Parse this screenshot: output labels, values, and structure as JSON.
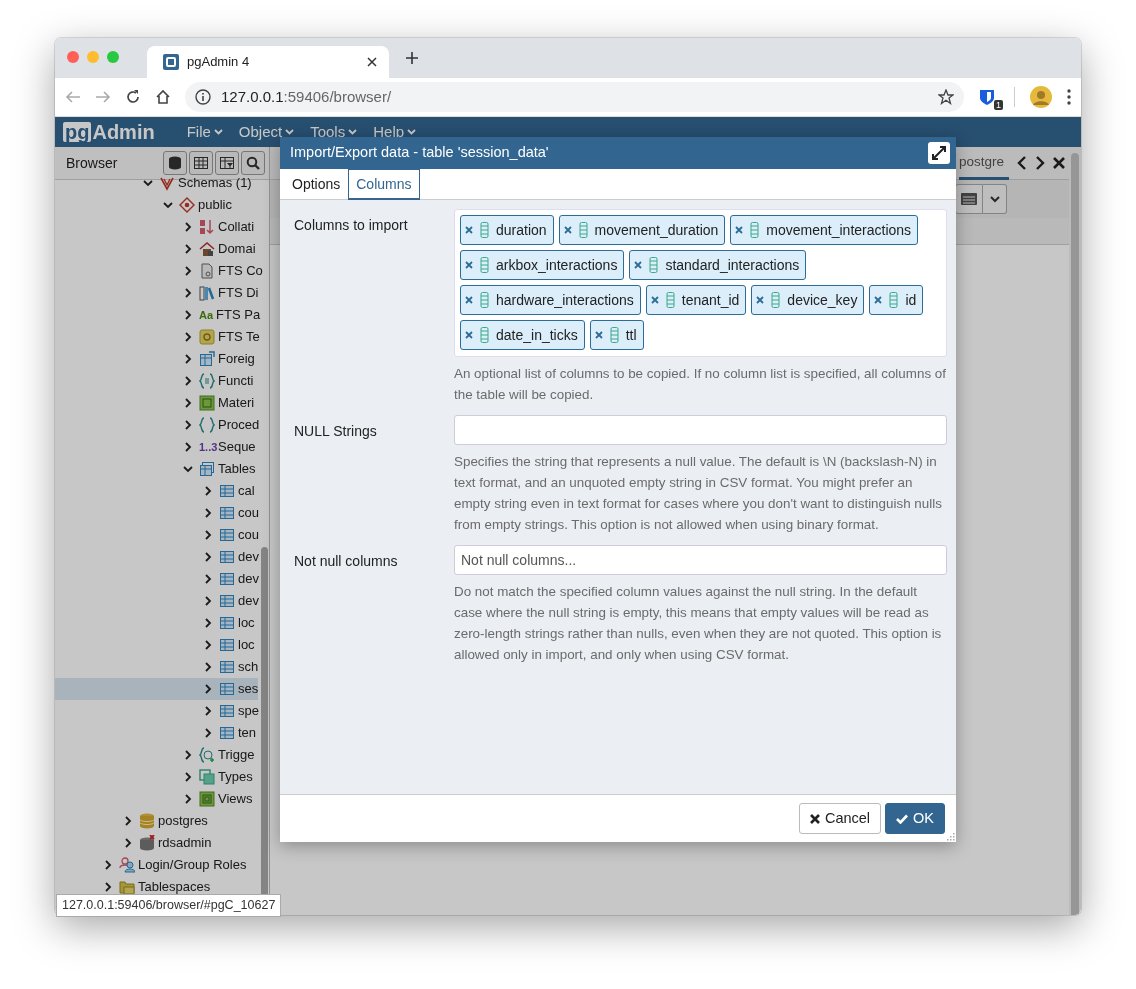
{
  "browser_tab": {
    "title": "pgAdmin 4"
  },
  "address_bar": {
    "host": "127.0.0.1",
    "path": ":59406/browser/"
  },
  "extension": {
    "badge": "1"
  },
  "app": {
    "logo": {
      "boxed": "pg",
      "text": "Admin"
    },
    "menus": [
      "File",
      "Object",
      "Tools",
      "Help"
    ]
  },
  "browser_panel": {
    "title": "Browser",
    "tree": [
      {
        "children": [
          {
            "children": [
              {
                "label": "Schemas (1)",
                "kind": "schemas",
                "expanded": true,
                "selected": false,
                "children": [
                  {
                    "label": "public",
                    "kind": "schema",
                    "expanded": true,
                    "selected": false,
                    "children": [
                      {
                        "label": "Collati",
                        "kind": "collations",
                        "expanded": false,
                        "selected": false
                      },
                      {
                        "label": "Domai",
                        "kind": "domains",
                        "expanded": false,
                        "selected": false
                      },
                      {
                        "label": "FTS Co",
                        "kind": "ftsconfig",
                        "expanded": false,
                        "selected": false
                      },
                      {
                        "label": "FTS Di",
                        "kind": "ftsdict",
                        "expanded": false,
                        "selected": false
                      },
                      {
                        "label": "FTS Pa",
                        "kind": "ftsparser",
                        "glyph": "Aa",
                        "expanded": false,
                        "selected": false
                      },
                      {
                        "label": "FTS Te",
                        "kind": "ftstemplate",
                        "expanded": false,
                        "selected": false
                      },
                      {
                        "label": "Foreig",
                        "kind": "foreign",
                        "expanded": false,
                        "selected": false
                      },
                      {
                        "label": "Functi",
                        "kind": "functions",
                        "expanded": false,
                        "selected": false
                      },
                      {
                        "label": "Materi",
                        "kind": "matviews",
                        "expanded": false,
                        "selected": false
                      },
                      {
                        "label": "Proced",
                        "kind": "procedures",
                        "expanded": false,
                        "selected": false
                      },
                      {
                        "label": "Seque",
                        "kind": "sequences",
                        "glyph": "1..3",
                        "expanded": false,
                        "selected": false
                      },
                      {
                        "label": "Tables",
                        "kind": "tables",
                        "expanded": true,
                        "selected": false,
                        "children": [
                          {
                            "label": "cal",
                            "kind": "table",
                            "expanded": false,
                            "selected": false
                          },
                          {
                            "label": "cou",
                            "kind": "table",
                            "expanded": false,
                            "selected": false
                          },
                          {
                            "label": "cou",
                            "kind": "table",
                            "expanded": false,
                            "selected": false
                          },
                          {
                            "label": "dev",
                            "kind": "table",
                            "expanded": false,
                            "selected": false
                          },
                          {
                            "label": "dev",
                            "kind": "table",
                            "expanded": false,
                            "selected": false
                          },
                          {
                            "label": "dev",
                            "kind": "table",
                            "expanded": false,
                            "selected": false
                          },
                          {
                            "label": "loc",
                            "kind": "table",
                            "expanded": false,
                            "selected": false
                          },
                          {
                            "label": "loc",
                            "kind": "table",
                            "expanded": false,
                            "selected": false
                          },
                          {
                            "label": "sch",
                            "kind": "table",
                            "expanded": false,
                            "selected": false
                          },
                          {
                            "label": "ses",
                            "kind": "table",
                            "expanded": false,
                            "selected": true
                          },
                          {
                            "label": "spe",
                            "kind": "table",
                            "expanded": false,
                            "selected": false
                          },
                          {
                            "label": "ten",
                            "kind": "table",
                            "expanded": false,
                            "selected": false
                          }
                        ]
                      },
                      {
                        "label": "Trigge",
                        "kind": "triggers",
                        "expanded": false,
                        "selected": false
                      },
                      {
                        "label": "Types",
                        "kind": "types",
                        "expanded": false,
                        "selected": false
                      },
                      {
                        "label": "Views",
                        "kind": "views",
                        "expanded": false,
                        "selected": false
                      }
                    ]
                  }
                ]
              }
            ]
          },
          {
            "label": "postgres",
            "kind": "database",
            "expanded": false,
            "selected": false
          },
          {
            "label": "rdsadmin",
            "kind": "databasedown",
            "expanded": false,
            "selected": false
          }
        ]
      },
      {
        "label": "Login/Group Roles",
        "kind": "roles",
        "expanded": false,
        "selected": false
      },
      {
        "label": "Tablespaces",
        "kind": "tablespaces",
        "expanded": false,
        "selected": false
      }
    ]
  },
  "right_panel": {
    "tab": "postgre"
  },
  "status_tooltip": "127.0.0.1:59406/browser/#pgC_10627",
  "dialog": {
    "title": "Import/Export data - table 'session_data'",
    "tabs": [
      {
        "label": "Options",
        "selected": false
      },
      {
        "label": "Columns",
        "selected": true
      }
    ],
    "fields": [
      {
        "kind": "tags",
        "label": "Columns to import",
        "tags": [
          "duration",
          "movement_duration",
          "movement_interactions",
          "arkbox_interactions",
          "standard_interactions",
          "hardware_interactions",
          "tenant_id",
          "device_key",
          "id",
          "date_in_ticks",
          "ttl"
        ],
        "help": "An optional list of columns to be copied. If no column list is specified, all columns of the table will be copied."
      },
      {
        "kind": "text",
        "label": "NULL Strings",
        "help": "Specifies the string that represents a null value. The default is \\N (backslash-N) in text format, and an unquoted empty string in CSV format. You might prefer an empty string even in text format for cases where you don't want to distinguish nulls from empty strings. This option is not allowed when using binary format."
      },
      {
        "kind": "select",
        "label": "Not null columns",
        "placeholder": "Not null columns...",
        "help": "Do not match the specified column values against the null string. In the default case where the null string is empty, this means that empty values will be read as zero-length strings rather than nulls, even when they are not quoted. This option is allowed only in import, and only when using CSV format."
      }
    ],
    "buttons": [
      {
        "label": "Cancel",
        "kind": "cancel"
      },
      {
        "label": "OK",
        "kind": "ok"
      }
    ]
  }
}
